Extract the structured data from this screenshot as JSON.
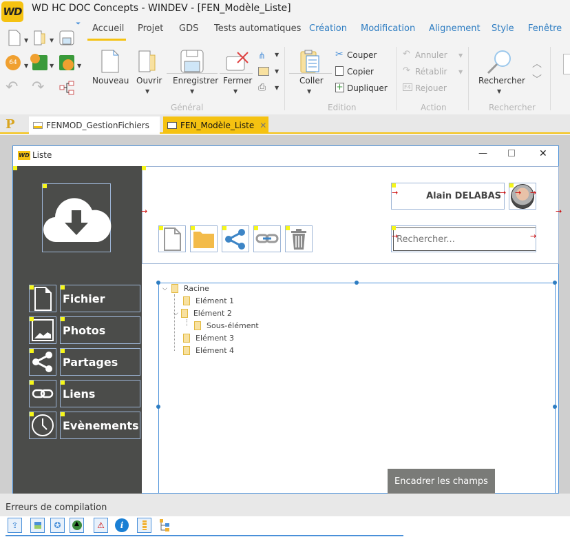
{
  "app": {
    "logo_text": "WD",
    "title": "WD HC DOC Concepts - WINDEV - [FEN_Modèle_Liste]"
  },
  "ribbon": {
    "tabs": [
      {
        "label": "Accueil",
        "active": true
      },
      {
        "label": "Projet"
      },
      {
        "label": "GDS"
      },
      {
        "label": "Tests automatiques"
      },
      {
        "label": "Création"
      },
      {
        "label": "Modification"
      },
      {
        "label": "Alignement"
      },
      {
        "label": "Style"
      },
      {
        "label": "Fenêtre"
      }
    ],
    "general": {
      "group_label": "Général",
      "nouveau": "Nouveau",
      "ouvrir": "Ouvrir",
      "enregistrer": "Enregistrer",
      "fermer": "Fermer"
    },
    "edition": {
      "group_label": "Edition",
      "coller": "Coller",
      "couper": "Couper",
      "copier": "Copier",
      "dupliquer": "Dupliquer"
    },
    "action": {
      "group_label": "Action",
      "annuler": "Annuler",
      "retablir": "Rétablir",
      "rejouer": "Rejouer"
    },
    "rechercher": {
      "group_label": "Rechercher",
      "label": "Rechercher"
    },
    "quick_access": {
      "badge_64": "64"
    }
  },
  "doc_tabs": [
    {
      "label": "FENMOD_GestionFichiers",
      "active": false
    },
    {
      "label": "FEN_Modèle_Liste",
      "active": true
    }
  ],
  "project_icon": "P",
  "window": {
    "logo_text": "WD",
    "title": "Liste",
    "user_name": "Alain DELABAS",
    "search_placeholder": "Rechercher...",
    "menu": [
      {
        "label": "Fichier",
        "icon": "file-icon"
      },
      {
        "label": "Photos",
        "icon": "image-icon"
      },
      {
        "label": "Partages",
        "icon": "share-icon"
      },
      {
        "label": "Liens",
        "icon": "link-icon"
      },
      {
        "label": "Evènements",
        "icon": "clock-icon"
      }
    ],
    "toolbar_icons": [
      "new-file-icon",
      "folder-icon",
      "share-icon",
      "link-icon",
      "trash-icon"
    ],
    "tree": [
      {
        "label": "Racine",
        "level": 0,
        "expanded": true
      },
      {
        "label": "Elément 1",
        "level": 1
      },
      {
        "label": "Elément 2",
        "level": 1,
        "expanded": true
      },
      {
        "label": "Sous-élément",
        "level": 2
      },
      {
        "label": "Elément 3",
        "level": 1
      },
      {
        "label": "Elément 4",
        "level": 1
      }
    ],
    "tooltip": "Encadrer les champs"
  },
  "bottom_panel": {
    "title": "Erreurs de compilation"
  },
  "colors": {
    "accent": "#f5c211",
    "sidebar": "#4b4c4a",
    "blue": "#2e7dc2",
    "tooltip_bg": "#7a7b78"
  }
}
